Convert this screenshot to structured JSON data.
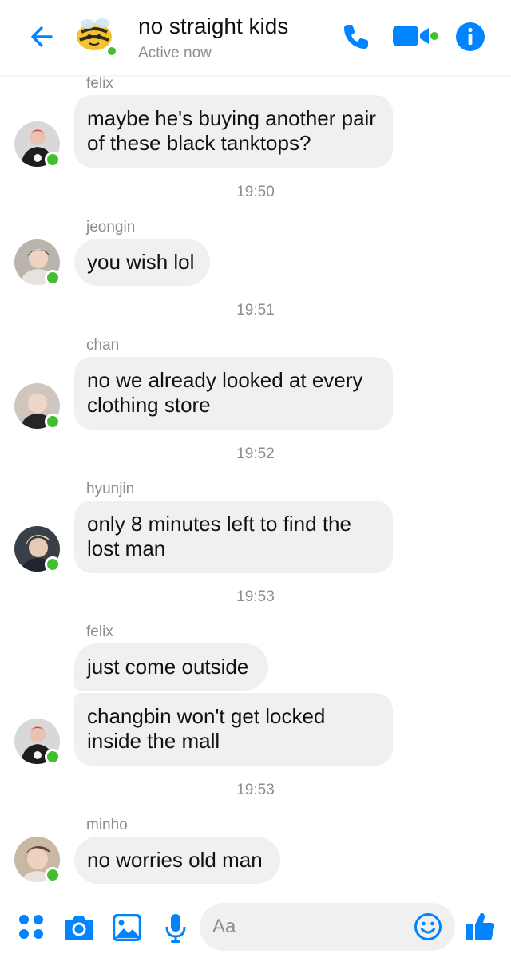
{
  "header": {
    "title": "no straight kids",
    "status": "Active now"
  },
  "colors": {
    "accent": "#0084ff",
    "online": "#44bd32",
    "bubble": "#f0f0f0",
    "meta_text": "#8a8d91"
  },
  "messages": [
    {
      "sender": "felix",
      "text": [
        "maybe he's buying another pair",
        "of these black tanktops?"
      ]
    },
    {
      "timestamp": "19:50"
    },
    {
      "sender": "jeongin",
      "text": [
        "you wish lol"
      ]
    },
    {
      "timestamp": "19:51"
    },
    {
      "sender": "chan",
      "text": [
        "no we already looked at every",
        "clothing store"
      ]
    },
    {
      "timestamp": "19:52"
    },
    {
      "sender": "hyunjin",
      "text": [
        "only 8 minutes left to find the",
        "lost man"
      ]
    },
    {
      "timestamp": "19:53"
    },
    {
      "sender": "felix",
      "text": [
        "just come outside"
      ]
    },
    {
      "text": [
        "changbin won't get locked",
        "inside the mall"
      ]
    },
    {
      "timestamp": "19:53"
    },
    {
      "sender": "minho",
      "text": [
        "no worries old man"
      ]
    }
  ],
  "composer": {
    "placeholder": "Aa",
    "icons": [
      "apps-icon",
      "camera-icon",
      "gallery-icon",
      "microphone-icon",
      "emoji-icon",
      "like-icon"
    ]
  },
  "header_icons": [
    "back-arrow-icon",
    "phone-call-icon",
    "video-call-icon",
    "info-icon"
  ]
}
